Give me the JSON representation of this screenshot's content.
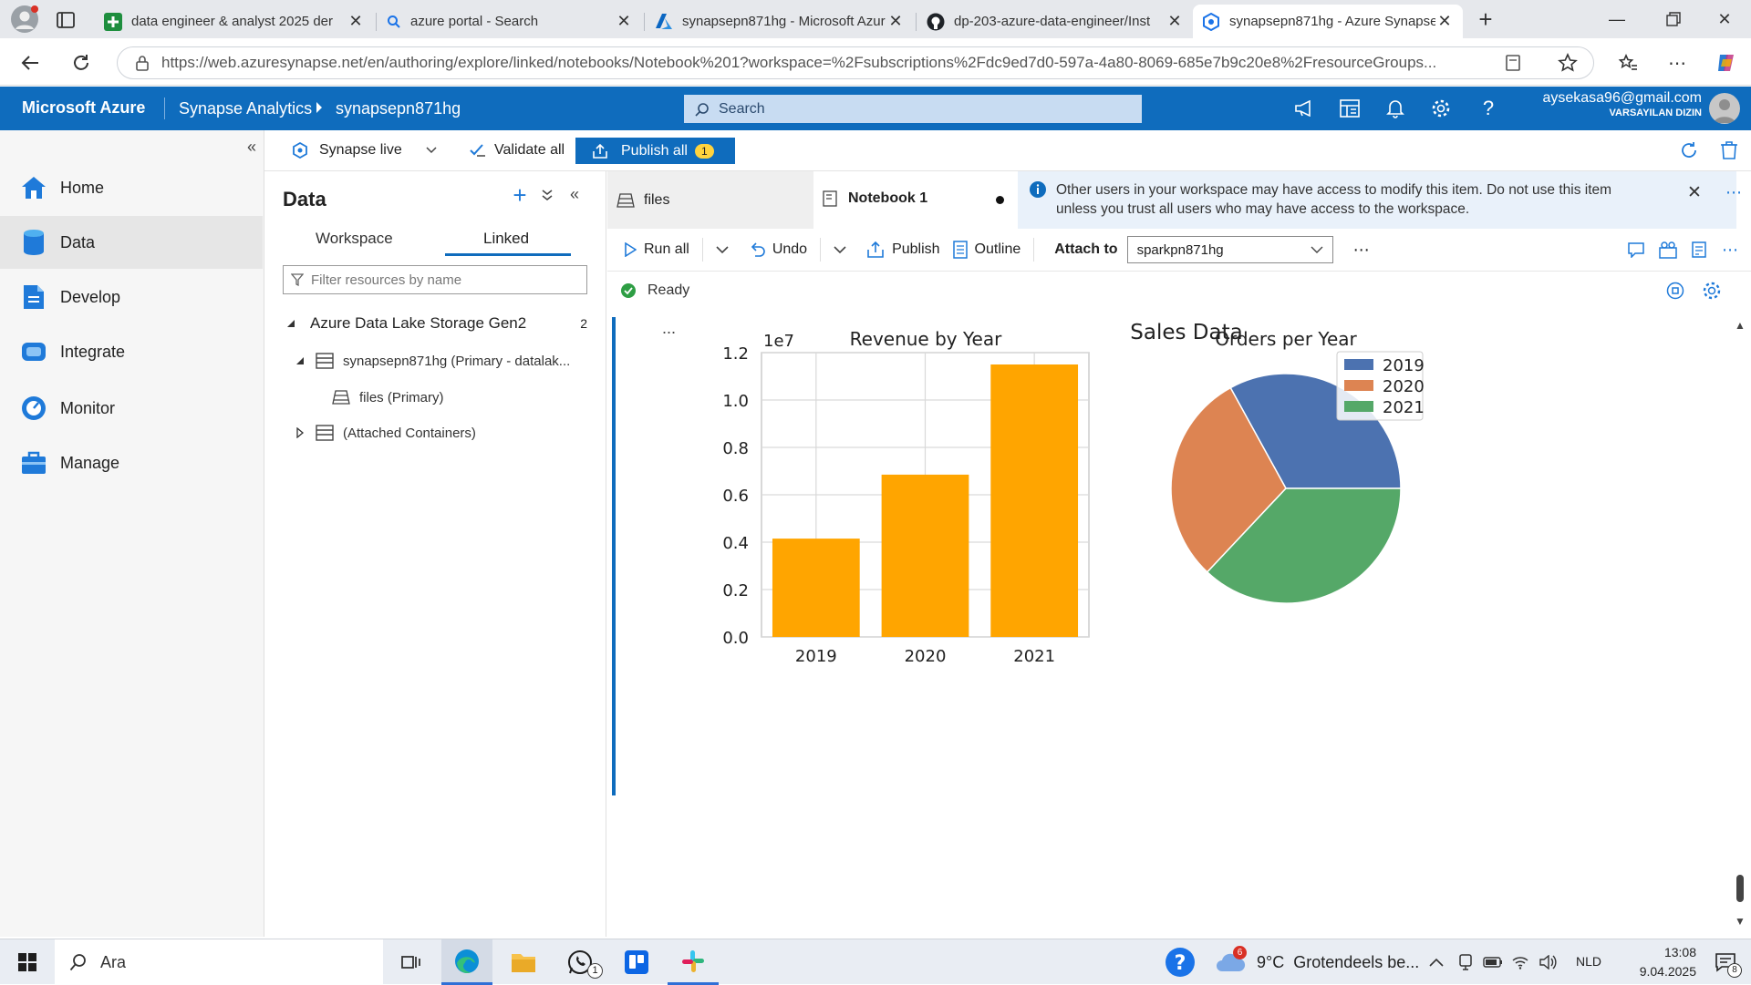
{
  "browser": {
    "tabs": [
      {
        "title": "data engineer & analyst 2025 der",
        "icon": "sheets-plus-icon"
      },
      {
        "title": "azure portal - Search",
        "icon": "search-icon"
      },
      {
        "title": "synapsepn871hg - Microsoft Azur",
        "icon": "azure-logo-icon"
      },
      {
        "title": "dp-203-azure-data-engineer/Inst",
        "icon": "github-icon"
      },
      {
        "title": "synapsepn871hg - Azure Synapse",
        "icon": "synapse-icon",
        "active": true
      }
    ],
    "url": "https://web.azuresynapse.net/en/authoring/explore/linked/notebooks/Notebook%201?workspace=%2Fsubscriptions%2Fdc9ed7d0-597a-4a80-8069-685e7b9c20e8%2FresourceGroups..."
  },
  "header": {
    "brand": "Microsoft Azure",
    "service": "Synapse Analytics",
    "workspace": "synapsepn871hg",
    "search_placeholder": "Search",
    "user_email": "aysekasa96@gmail.com",
    "user_directory": "VARSAYILAN DIZIN"
  },
  "toolbar": {
    "synapse_live": "Synapse live",
    "validate_all": "Validate all",
    "publish_all": "Publish all",
    "publish_count": "1"
  },
  "leftnav": {
    "items": [
      {
        "label": "Home",
        "icon": "home-icon"
      },
      {
        "label": "Data",
        "icon": "data-icon",
        "selected": true
      },
      {
        "label": "Develop",
        "icon": "develop-icon"
      },
      {
        "label": "Integrate",
        "icon": "integrate-icon"
      },
      {
        "label": "Monitor",
        "icon": "monitor-icon"
      },
      {
        "label": "Manage",
        "icon": "manage-icon"
      }
    ]
  },
  "data_panel": {
    "title": "Data",
    "tabs": [
      "Workspace",
      "Linked"
    ],
    "active_tab": "Linked",
    "filter_placeholder": "Filter resources by name",
    "tree": {
      "group": "Azure Data Lake Storage Gen2",
      "group_count": "2",
      "primary": "synapsepn871hg (Primary - datalak...",
      "files": "files (Primary)",
      "attached": "(Attached Containers)"
    }
  },
  "editor": {
    "tabs": [
      {
        "label": "files"
      },
      {
        "label": "Notebook 1",
        "active": true
      }
    ],
    "banner": "Other users in your workspace may have access to modify this item. Do not use this item unless you trust all users who may have access to the workspace.",
    "commands": {
      "run_all": "Run all",
      "undo": "Undo",
      "publish": "Publish",
      "outline": "Outline",
      "attach_to_label": "Attach to",
      "attach_to_value": "sparkpn871hg"
    },
    "status": "Ready",
    "cell_menu": "..."
  },
  "chart_data": {
    "title": "Sales Data",
    "charts": [
      {
        "type": "bar",
        "title": "Revenue by Year",
        "categories": [
          "2019",
          "2020",
          "2021"
        ],
        "values": [
          4150000,
          6850000,
          11500000
        ],
        "color": "#ffa500",
        "ylim": [
          0,
          12000000
        ],
        "yticks": [
          "0.0",
          "0.2",
          "0.4",
          "0.6",
          "0.8",
          "1.0",
          "1.2"
        ],
        "offset_label": "1e7",
        "grid": true
      },
      {
        "type": "pie",
        "title": "Orders per Year",
        "labels": [
          "2019",
          "2020",
          "2021"
        ],
        "values": [
          0.33,
          0.3,
          0.37
        ],
        "colors": [
          "#4c72b0",
          "#dd8452",
          "#55a868"
        ],
        "legend": "top-right"
      }
    ]
  },
  "taskbar": {
    "search_placeholder": "Ara",
    "weather_temp": "9°C",
    "weather_text": "Grotendeels be...",
    "weather_badge": "6",
    "lang": "NLD",
    "time": "13:08",
    "date": "9.04.2025",
    "notif_count": "8",
    "whatsapp_badge": "1"
  }
}
